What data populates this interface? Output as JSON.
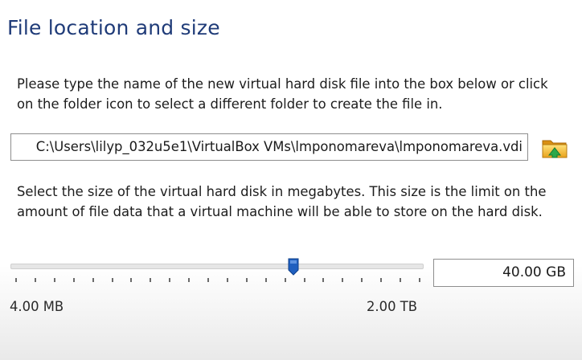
{
  "header": {
    "title": "File location and size"
  },
  "location": {
    "instructions": "Please type the name of the new virtual hard disk file into the box below or click on the folder icon to select a different folder to create the file in.",
    "path_value": "C:\\Users\\lilyp_032u5e1\\VirtualBox VMs\\lmponomareva\\lmponomareva.vdi",
    "folder_button_icon": "folder-icon"
  },
  "size": {
    "instructions": "Select the size of the virtual hard disk in megabytes. This size is the limit on the amount of file data that a virtual machine will be able to store on the hard disk.",
    "value": "40.00 GB",
    "slider_fraction": 0.69,
    "min_label": "4.00 MB",
    "max_label": "2.00 TB",
    "accent": "#1f5fbf"
  }
}
